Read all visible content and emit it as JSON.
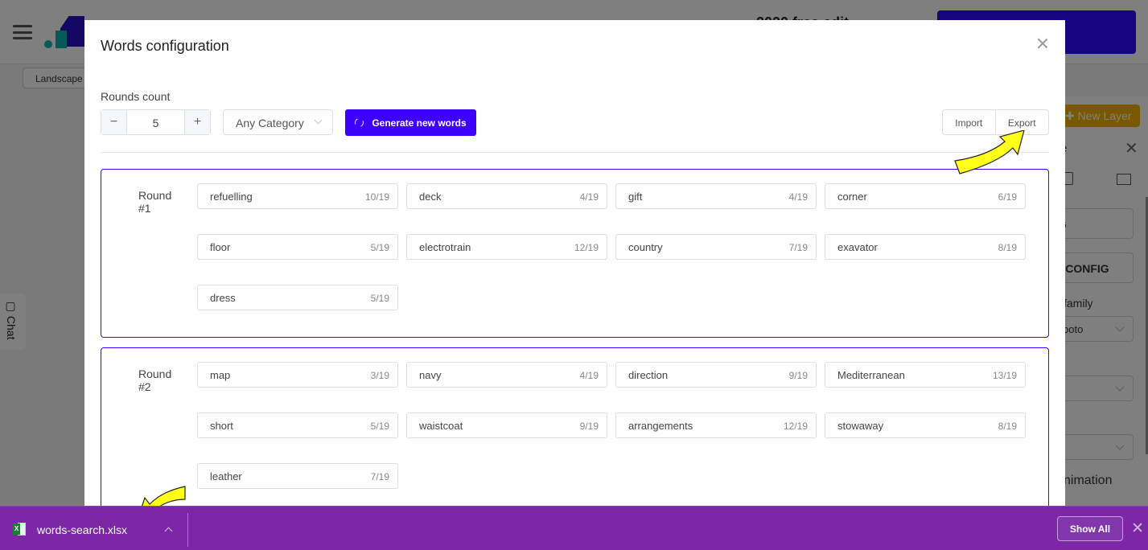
{
  "background": {
    "header_title": "2020 free edit",
    "landscape_label": "Landscape",
    "new_layer_label": "New Layer",
    "panel_title": "e",
    "config_button_1": "IG",
    "config_button_2": "E CONFIG",
    "font_family_label": "family",
    "font_family_value": "boto",
    "animation_label": "nimation",
    "chat_label": "Chat"
  },
  "modal": {
    "title": "Words configuration",
    "rounds_label": "Rounds count",
    "rounds_value": "5",
    "minus_label": "−",
    "plus_label": "+",
    "category_value": "Any Category",
    "generate_label": "Generate new words",
    "import_label": "Import",
    "export_label": "Export",
    "rounds": [
      {
        "label": "Round #1",
        "words": [
          {
            "word": "refuelling",
            "count": "10/19"
          },
          {
            "word": "deck",
            "count": "4/19"
          },
          {
            "word": "gift",
            "count": "4/19"
          },
          {
            "word": "corner",
            "count": "6/19"
          },
          {
            "word": "floor",
            "count": "5/19"
          },
          {
            "word": "electrotrain",
            "count": "12/19"
          },
          {
            "word": "country",
            "count": "7/19"
          },
          {
            "word": "exavator",
            "count": "8/19"
          },
          {
            "word": "dress",
            "count": "5/19"
          }
        ]
      },
      {
        "label": "Round #2",
        "words": [
          {
            "word": "map",
            "count": "3/19"
          },
          {
            "word": "navy",
            "count": "4/19"
          },
          {
            "word": "direction",
            "count": "9/19"
          },
          {
            "word": "Mediterranean",
            "count": "13/19"
          },
          {
            "word": "short",
            "count": "5/19"
          },
          {
            "word": "waistcoat",
            "count": "9/19"
          },
          {
            "word": "arrangements",
            "count": "12/19"
          },
          {
            "word": "stowaway",
            "count": "8/19"
          },
          {
            "word": "leather",
            "count": "7/19"
          }
        ]
      }
    ]
  },
  "download_bar": {
    "file_name": "words-search.xlsx",
    "file_icon": "excel-icon",
    "show_all_label": "Show All"
  },
  "colors": {
    "accent": "#3d00ff",
    "download_bar": "#7b27a6",
    "annotation_arrow": "#ffff00"
  }
}
